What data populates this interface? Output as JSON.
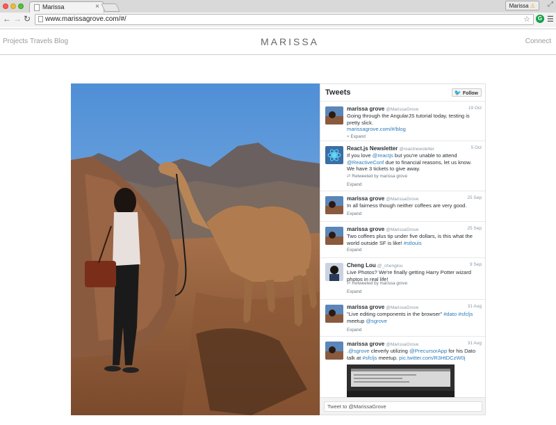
{
  "browser": {
    "tab_title": "Marissa",
    "tab_close": "×",
    "profile_name": "Marissa",
    "url": "www.marissagrove.com/#/",
    "icons": [
      "back-arrow-icon",
      "forward-arrow-icon",
      "reload-icon",
      "star-icon",
      "grammarly-icon",
      "menu-icon"
    ]
  },
  "site": {
    "brand": "MARISSA",
    "nav": [
      "Projects",
      "Travels",
      "Blog"
    ],
    "connect": "Connect"
  },
  "widget": {
    "title": "Tweets",
    "follow_label": "Follow",
    "composer_placeholder": "Tweet to @MarissaGrove",
    "accent": "#2b7bb9",
    "tweets": [
      {
        "name": "marissa grove",
        "handle": "@MarissaGrove",
        "date": "19 Oct",
        "text": "Going through the AngularJS tutorial today, testing is pretty slick.",
        "link": "marissagrove.com/#/blog",
        "meta": "Expand"
      },
      {
        "name": "React.js Newsletter",
        "handle": "@reactnewsletter",
        "date": "5 Oct",
        "text_1": "If you love ",
        "link_1": "@reactjs",
        "text_2": " but you're unable to attend ",
        "link_2": "@ReactiveConf",
        "text_3": " due to financial reasons, let us know. We have 3 tickets to give away.",
        "retweeted": "Retweeted by marissa grove",
        "meta": "Expand"
      },
      {
        "name": "marissa grove",
        "handle": "@MarissaGrove",
        "date": "25 Sep",
        "text": "In all fairness though neither coffees are very good.",
        "meta": "Expand"
      },
      {
        "name": "marissa grove",
        "handle": "@MarissaGrove",
        "date": "25 Sep",
        "text": "Two coffees plus tip under five dollars, is this what the world outside SF is like! ",
        "link": "#stlouis",
        "meta": "Expand"
      },
      {
        "name": "Cheng Lou",
        "handle": "@_chenglou",
        "date": "9 Sep",
        "text": "Live Photos? We're finally getting Harry Potter wizard photos in real life!",
        "retweeted": "Retweeted by marissa grove",
        "meta": "Expand"
      },
      {
        "name": "marissa grove",
        "handle": "@MarissaGrove",
        "date": "31 Aug",
        "text": "\"Live editing components in the browser\" ",
        "link_1": "#dato",
        "link_2": "#sfcljs",
        "text_2": "meetup ",
        "link_3": "@sgrove",
        "meta": "Expand"
      },
      {
        "name": "marissa grove",
        "handle": "@MarissaGrove",
        "date": "31 Aug",
        "link_1": ".@sgrove",
        "text_1": " cleverly utilizing ",
        "link_2": "@PrecursorApp",
        "text_2": " for his Dato talk at ",
        "link_3": "#sfcljs",
        "text_3": " meetup. ",
        "link_4": "pic.twitter.com/R3HtDCzW0j"
      }
    ]
  }
}
